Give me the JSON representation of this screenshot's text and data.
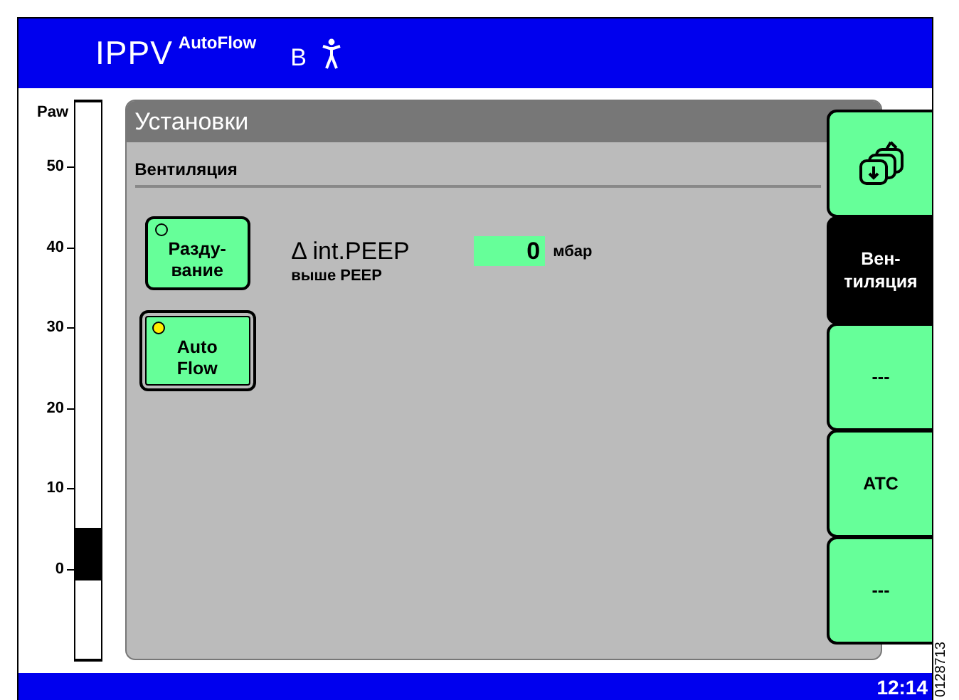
{
  "header": {
    "mode": "IPPV",
    "mode_suffix": "AutoFlow",
    "patient_type": "B"
  },
  "gauge": {
    "label": "Paw",
    "ticks": [
      "50",
      "40",
      "30",
      "20",
      "10",
      "0"
    ],
    "level": 0.11
  },
  "panel": {
    "title": "Установки",
    "section": "Вентиляция",
    "buttons": [
      {
        "lines": [
          "Разду-",
          "вание"
        ],
        "active": false
      },
      {
        "lines": [
          "Auto",
          "Flow"
        ],
        "active": true
      }
    ],
    "parameter": {
      "name": "Δ int.PEEP",
      "note": "выше PEEP",
      "value": "0",
      "unit": "мбар"
    }
  },
  "side_tabs": [
    {
      "kind": "icon",
      "selected": false
    },
    {
      "kind": "text",
      "lines": [
        "Вен-",
        "тиляция"
      ],
      "selected": true
    },
    {
      "kind": "text",
      "lines": [
        "---"
      ],
      "selected": false
    },
    {
      "kind": "text",
      "lines": [
        "ATC"
      ],
      "selected": false
    },
    {
      "kind": "text",
      "lines": [
        "---"
      ],
      "selected": false
    }
  ],
  "status_bar": {
    "time": "12:14"
  },
  "figure_id": "0128713"
}
